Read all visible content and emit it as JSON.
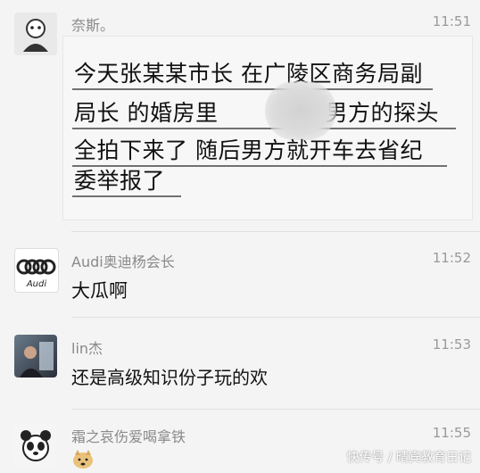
{
  "messages": [
    {
      "name": "奈斯。",
      "time": "11:51",
      "lines": [
        "今天张某某市长 在广陵区商务局副",
        "局长 的婚房里",
        "被男方的探头",
        "全拍下来了 随后男方就开车去省纪",
        "委举报了"
      ]
    },
    {
      "name": "Audi奥迪杨会长",
      "time": "11:52",
      "text": "大瓜啊",
      "avatar_text": "Audi"
    },
    {
      "name": "lin杰",
      "time": "11:53",
      "text": "还是高级知识份子玩的欢"
    },
    {
      "name": "霜之哀伤爱喝拿铁",
      "time": "11:55"
    }
  ],
  "watermark": "快传号 / 晴宾教育日记",
  "colors": {
    "background": "#f4f4f4",
    "text": "#111111",
    "meta": "#8a8a8a"
  }
}
